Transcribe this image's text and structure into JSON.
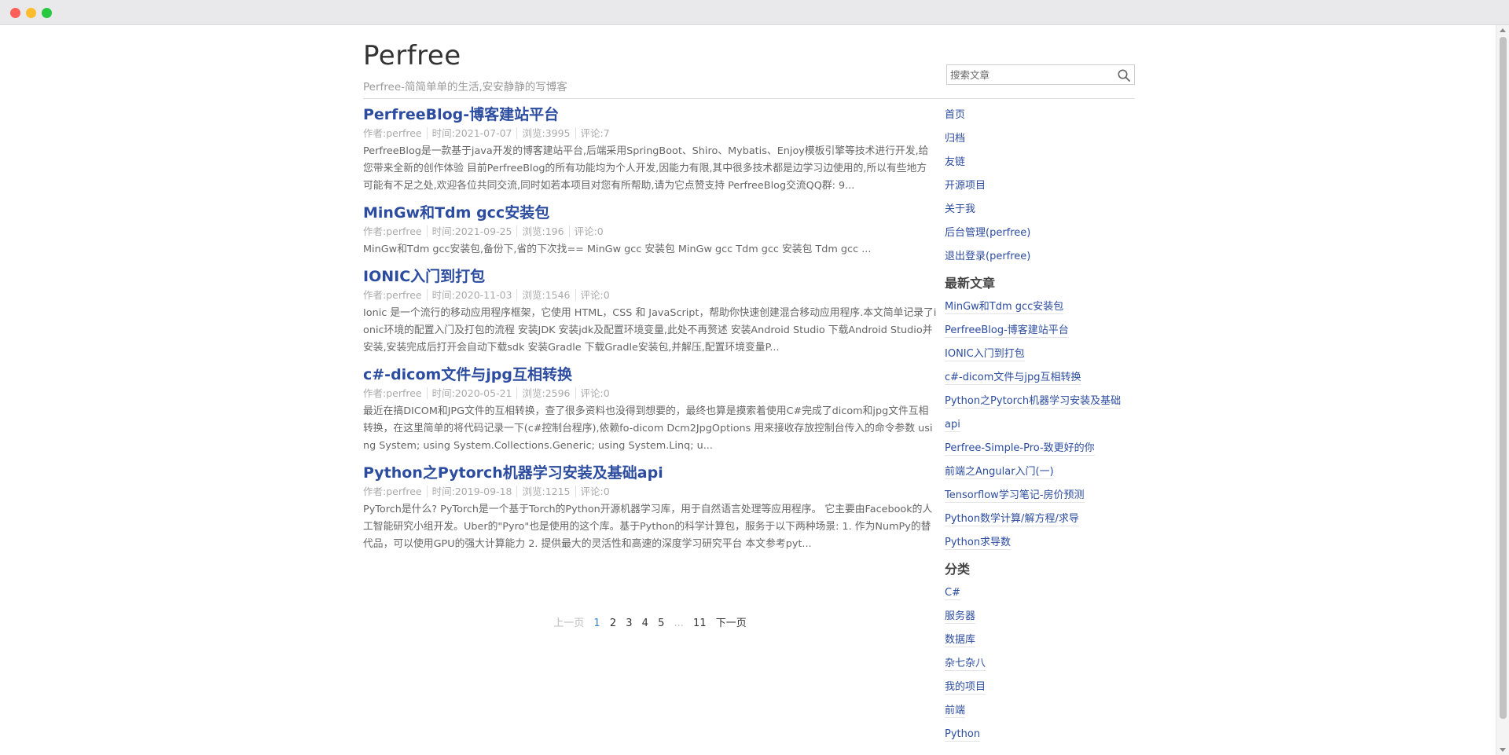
{
  "window": {
    "buttons": [
      "close",
      "minimize",
      "maximize"
    ]
  },
  "site": {
    "title": "Perfree",
    "subtitle": "Perfree-简简单单的生活,安安静静的写博客"
  },
  "search": {
    "placeholder": "搜索文章",
    "icon": "search-icon"
  },
  "posts": [
    {
      "title": "PerfreeBlog-博客建站平台",
      "author": "作者:perfree",
      "time": "时间:2021-07-07",
      "views": "浏览:3995",
      "comments": "评论:7",
      "excerpt": "PerfreeBlog是一款基于java开发的博客建站平台,后端采用SpringBoot、Shiro、Mybatis、Enjoy模板引擎等技术进行开发,给您带来全新的创作体验 目前PerfreeBlog的所有功能均为个人开发,因能力有限,其中很多技术都是边学习边使用的,所以有些地方可能有不足之处,欢迎各位共同交流,同时如若本项目对您有所帮助,请为它点赞支持 PerfreeBlog交流QQ群: 9..."
    },
    {
      "title": "MinGw和Tdm gcc安装包",
      "author": "作者:perfree",
      "time": "时间:2021-09-25",
      "views": "浏览:196",
      "comments": "评论:0",
      "excerpt": "MinGw和Tdm gcc安装包,备份下,省的下次找== MinGw gcc 安装包 MinGw gcc Tdm gcc 安装包 Tdm gcc ..."
    },
    {
      "title": "IONIC入门到打包",
      "author": "作者:perfree",
      "time": "时间:2020-11-03",
      "views": "浏览:1546",
      "comments": "评论:0",
      "excerpt": "Ionic 是一个流行的移动应用程序框架，它使用 HTML，CSS 和 JavaScript，帮助你快速创建混合移动应用程序.本文简单记录了ionic环境的配置入门及打包的流程 安装JDK 安装jdk及配置环境变量,此处不再赘述 安装Android Studio 下载Android Studio并安装,安装完成后打开会自动下载sdk 安装Gradle 下载Gradle安装包,并解压,配置环境变量P..."
    },
    {
      "title": "c#-dicom文件与jpg互相转换",
      "author": "作者:perfree",
      "time": "时间:2020-05-21",
      "views": "浏览:2596",
      "comments": "评论:0",
      "excerpt": "最近在搞DICOM和JPG文件的互相转换，查了很多资料也没得到想要的，最终也算是摸索着使用C#完成了dicom和jpg文件互相转换，在这里简单的将代码记录一下(c#控制台程序),依赖fo-dicom Dcm2JpgOptions 用来接收存放控制台传入的命令参数 using System; using System.Collections.Generic; using System.Linq; u..."
    },
    {
      "title": "Python之Pytorch机器学习安装及基础api",
      "author": "作者:perfree",
      "time": "时间:2019-09-18",
      "views": "浏览:1215",
      "comments": "评论:0",
      "excerpt": "PyTorch是什么? PyTorch是一个基于Torch的Python开源机器学习库，用于自然语言处理等应用程序。 它主要由Facebook的人工智能研究小组开发。Uber的\"Pyro\"也是使用的这个库。基于Python的科学计算包，服务于以下两种场景: 1. 作为NumPy的替代品，可以使用GPU的强大计算能力 2. 提供最大的灵活性和高速的深度学习研究平台 本文参考pyt..."
    }
  ],
  "pagination": {
    "prev": "上一页",
    "pages": [
      "1",
      "2",
      "3",
      "4",
      "5"
    ],
    "current": "1",
    "ellipsis": "...",
    "last": "11",
    "next": "下一页"
  },
  "sidebar": {
    "nav": [
      "首页",
      "归档",
      "友链",
      "开源项目",
      "关于我",
      "后台管理(perfree)",
      "退出登录(perfree)"
    ],
    "latest_heading": "最新文章",
    "latest": [
      "MinGw和Tdm gcc安装包",
      "PerfreeBlog-博客建站平台",
      "IONIC入门到打包",
      "c#-dicom文件与jpg互相转换",
      "Python之Pytorch机器学习安装及基础",
      "api",
      "Perfree-Simple-Pro-致更好的你",
      "前端之Angular入门(一)",
      "Tensorflow学习笔记-房价预测",
      "Python数学计算/解方程/求导",
      "Python求导数"
    ],
    "category_heading": "分类",
    "categories": [
      "C#",
      "服务器",
      "数据库",
      "杂七杂八",
      "我的项目",
      "前端",
      "Python"
    ]
  },
  "colors": {
    "link": "#2c4c9f",
    "current_page": "#3c83c9",
    "meta": "#aaaaaa"
  }
}
